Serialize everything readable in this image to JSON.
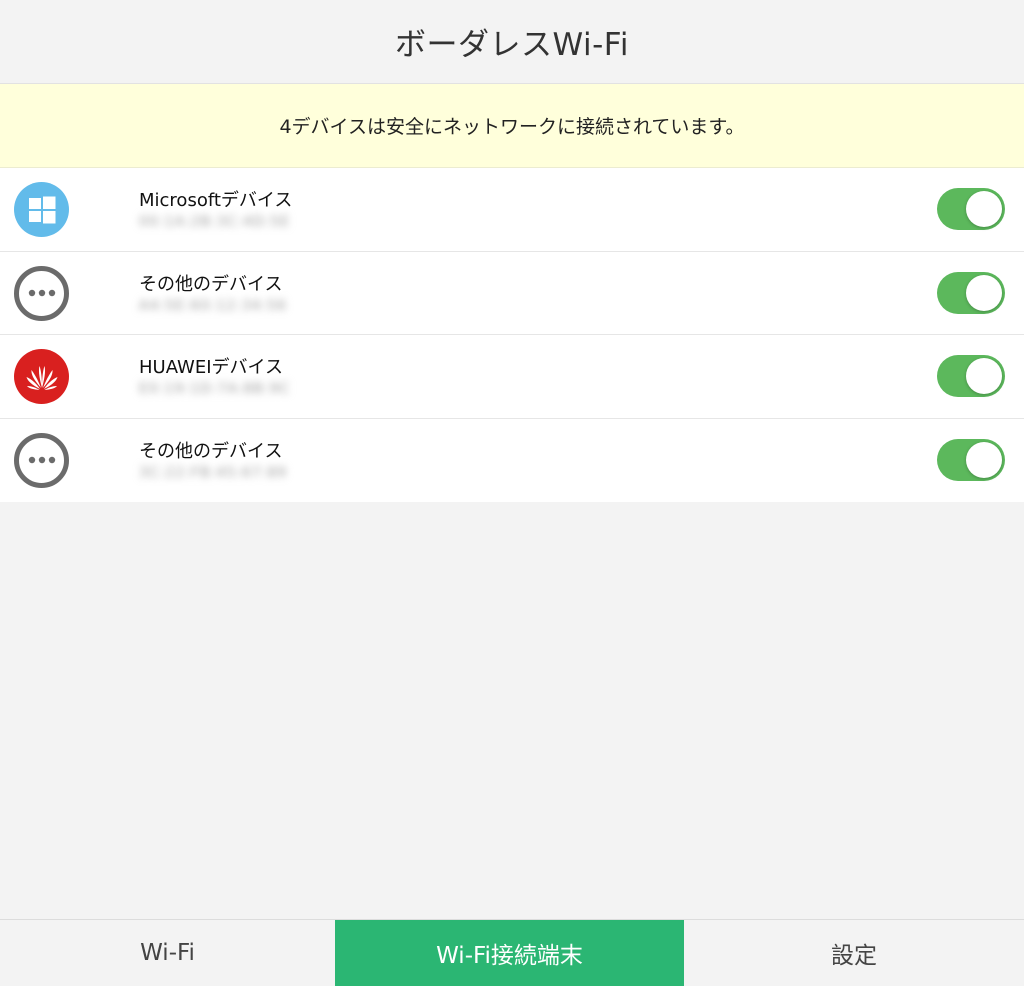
{
  "header": {
    "title": "ボーダレスWi-Fi"
  },
  "notice": {
    "text": "4デバイスは安全にネットワークに接続されています。"
  },
  "devices": [
    {
      "name": "Microsoftデバイス",
      "mac": "00:1A:2B:3C:4D:5E",
      "icon": "windows-icon",
      "connected": true
    },
    {
      "name": "その他のデバイス",
      "mac": "A4:5E:60:12:34:56",
      "icon": "more-icon",
      "connected": true
    },
    {
      "name": "HUAWEIデバイス",
      "mac": "E0:19:1D:7A:8B:9C",
      "icon": "huawei-icon",
      "connected": true
    },
    {
      "name": "その他のデバイス",
      "mac": "3C:22:FB:45:67:89",
      "icon": "more-icon",
      "connected": true
    }
  ],
  "tabs": [
    {
      "label": "Wi-Fi",
      "active": false
    },
    {
      "label": "Wi-Fi接続端末",
      "active": true
    },
    {
      "label": "設定",
      "active": false
    }
  ],
  "colors": {
    "accent": "#2bb673",
    "toggle_on": "#5cb85c",
    "notice_bg": "#ffffdb",
    "microsoft": "#62bbea",
    "huawei": "#d9201f"
  }
}
